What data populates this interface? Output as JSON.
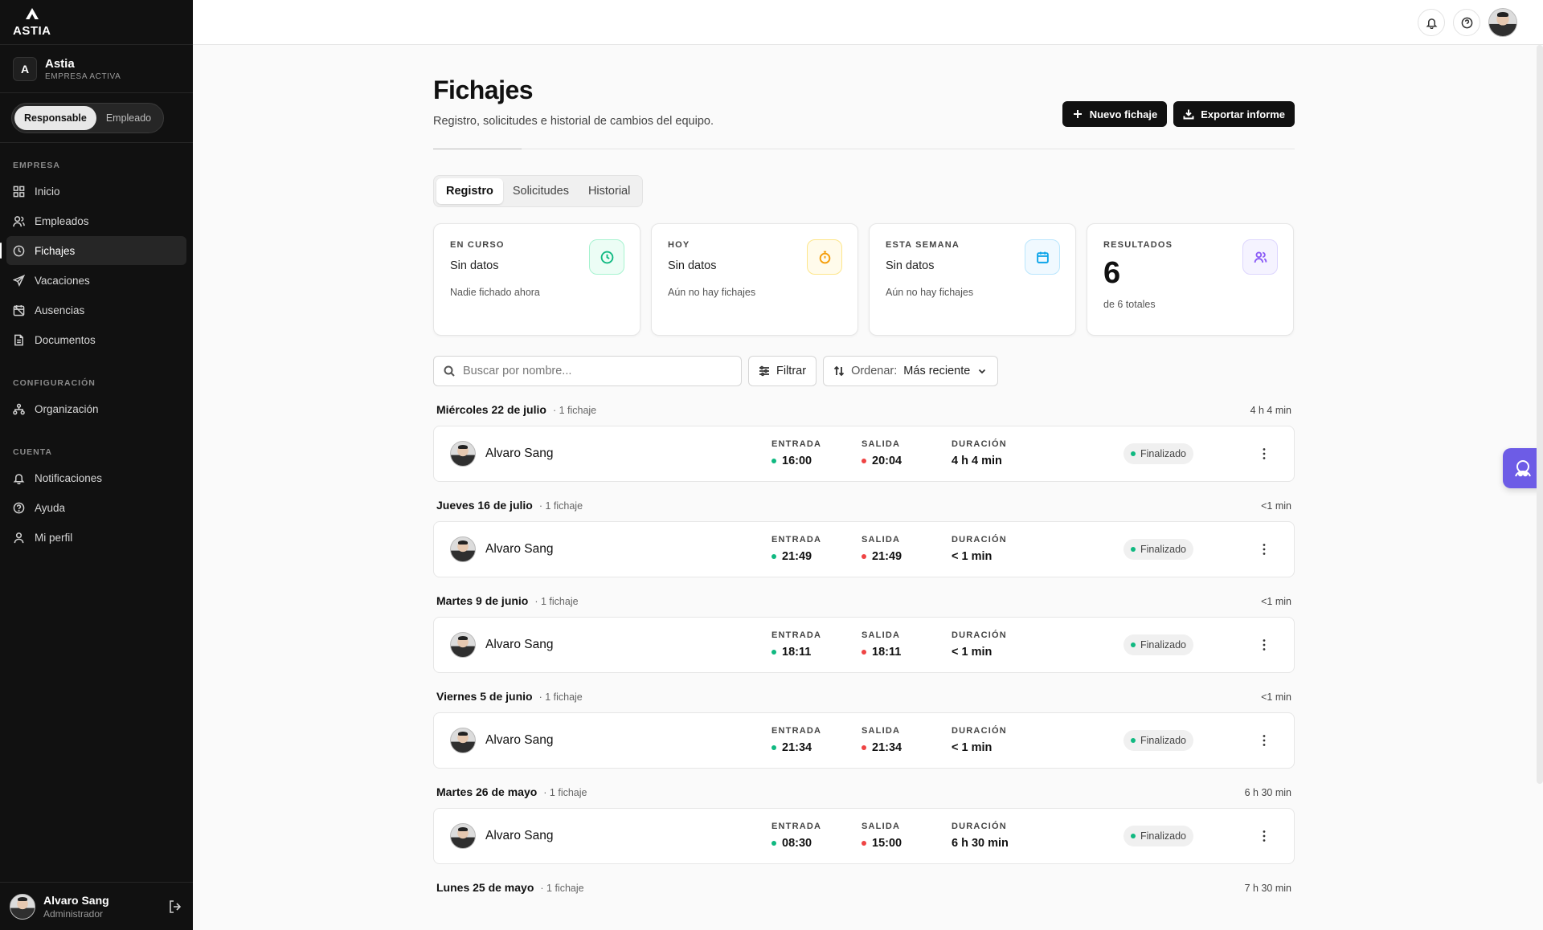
{
  "brand": {
    "logo_text": "ASTIA"
  },
  "company": {
    "badge": "A",
    "name": "Astia",
    "sub": "EMPRESA ACTIVA"
  },
  "roles": {
    "active": "Responsable",
    "other": "Empleado"
  },
  "nav": {
    "sections": [
      {
        "title": "EMPRESA",
        "items": [
          {
            "label": "Inicio",
            "icon": "grid-icon"
          },
          {
            "label": "Empleados",
            "icon": "users-icon"
          },
          {
            "label": "Fichajes",
            "icon": "clock-icon",
            "active": true
          },
          {
            "label": "Vacaciones",
            "icon": "plane-icon"
          },
          {
            "label": "Ausencias",
            "icon": "calendar-off-icon"
          },
          {
            "label": "Documentos",
            "icon": "document-icon"
          }
        ]
      },
      {
        "title": "CONFIGURACIÓN",
        "items": [
          {
            "label": "Organización",
            "icon": "org-icon"
          }
        ]
      },
      {
        "title": "CUENTA",
        "items": [
          {
            "label": "Notificaciones",
            "icon": "bell-icon"
          },
          {
            "label": "Ayuda",
            "icon": "help-icon"
          },
          {
            "label": "Mi perfil",
            "icon": "user-icon"
          }
        ]
      }
    ]
  },
  "user": {
    "name": "Alvaro Sang",
    "role": "Administrador"
  },
  "page": {
    "title": "Fichajes",
    "subtitle": "Registro, solicitudes e historial de cambios del equipo.",
    "new_label": "Nuevo fichaje",
    "export_label": "Exportar informe"
  },
  "tabs": [
    "Registro",
    "Solicitudes",
    "Historial"
  ],
  "stats": [
    {
      "label": "EN CURSO",
      "value": "Sin datos",
      "note": "Nadie fichado ahora",
      "icon": "clock-icon",
      "color": "#10b981",
      "bg": "#ecfdf5"
    },
    {
      "label": "HOY",
      "value": "Sin datos",
      "note": "Aún no hay fichajes",
      "icon": "stopwatch-icon",
      "color": "#f59e0b",
      "bg": "#fffbeb"
    },
    {
      "label": "ESTA SEMANA",
      "value": "Sin datos",
      "note": "Aún no hay fichajes",
      "icon": "calendar-icon",
      "color": "#0ea5e9",
      "bg": "#f0f9ff"
    },
    {
      "label": "RESULTADOS",
      "value": "6",
      "note": "de 6 totales",
      "icon": "users-icon",
      "color": "#8b5cf6",
      "bg": "#f5f3ff"
    }
  ],
  "toolbar": {
    "search_placeholder": "Buscar por nombre...",
    "filter_label": "Filtrar",
    "sort_label": "Ordenar:",
    "sort_value": "Más reciente"
  },
  "columns": {
    "in": "ENTRADA",
    "out": "SALIDA",
    "duration": "DURACIÓN"
  },
  "groups": [
    {
      "date": "Miércoles 22 de julio",
      "count": "· 1 fichaje",
      "total": "4 h 4 min",
      "entry": {
        "name": "Alvaro Sang",
        "in": "16:00",
        "out": "20:04",
        "duration": "4 h 4 min",
        "status": "Finalizado"
      }
    },
    {
      "date": "Jueves 16 de julio",
      "count": "· 1 fichaje",
      "total": "<1 min",
      "entry": {
        "name": "Alvaro Sang",
        "in": "21:49",
        "out": "21:49",
        "duration": "< 1 min",
        "status": "Finalizado"
      }
    },
    {
      "date": "Martes 9 de junio",
      "count": "· 1 fichaje",
      "total": "<1 min",
      "entry": {
        "name": "Alvaro Sang",
        "in": "18:11",
        "out": "18:11",
        "duration": "< 1 min",
        "status": "Finalizado"
      }
    },
    {
      "date": "Viernes 5 de junio",
      "count": "· 1 fichaje",
      "total": "<1 min",
      "entry": {
        "name": "Alvaro Sang",
        "in": "21:34",
        "out": "21:34",
        "duration": "< 1 min",
        "status": "Finalizado"
      }
    },
    {
      "date": "Martes 26 de mayo",
      "count": "· 1 fichaje",
      "total": "6 h 30 min",
      "entry": {
        "name": "Alvaro Sang",
        "in": "08:30",
        "out": "15:00",
        "duration": "6 h 30 min",
        "status": "Finalizado"
      }
    },
    {
      "date": "Lunes 25 de mayo",
      "count": "· 1 fichaje",
      "total": "7 h 30 min"
    }
  ],
  "colors": {
    "in_dot": "#10b981",
    "out_dot": "#ef4444",
    "status_dot": "#10b981",
    "assistant": "#6d5ce6"
  }
}
